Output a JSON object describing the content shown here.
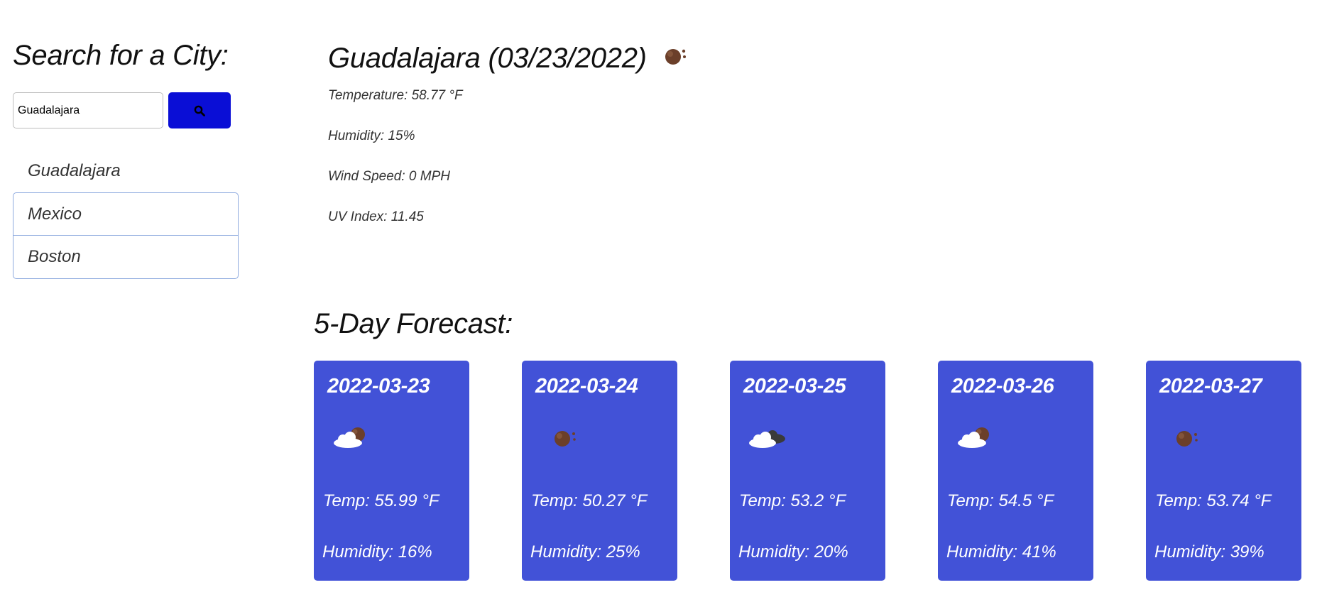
{
  "sidebar": {
    "title": "Search for a City:",
    "search_value": "Guadalajara",
    "search_button_icon": "search-icon",
    "history": [
      {
        "label": "Guadalajara"
      },
      {
        "label": "Mexico"
      },
      {
        "label": "Boston"
      }
    ]
  },
  "current": {
    "title": "Guadalajara (03/23/2022)",
    "icon": "clear-sky-icon",
    "temperature": "Temperature: 58.77 °F",
    "humidity": "Humidity: 15%",
    "wind_speed": "Wind Speed: 0 MPH",
    "uv_index": "UV Index: 11.45"
  },
  "forecast": {
    "title": "5-Day Forecast:",
    "days": [
      {
        "date": "2022-03-23",
        "icon": "few-clouds-icon",
        "temp": "Temp: 55.99 °F",
        "humidity": "Humidity: 16%"
      },
      {
        "date": "2022-03-24",
        "icon": "clear-sky-icon",
        "temp": "Temp: 50.27 °F",
        "humidity": "Humidity: 25%"
      },
      {
        "date": "2022-03-25",
        "icon": "broken-clouds-icon",
        "temp": "Temp: 53.2 °F",
        "humidity": "Humidity: 20%"
      },
      {
        "date": "2022-03-26",
        "icon": "few-clouds-icon",
        "temp": "Temp: 54.5 °F",
        "humidity": "Humidity: 41%"
      },
      {
        "date": "2022-03-27",
        "icon": "clear-sky-icon",
        "temp": "Temp: 53.74 °F",
        "humidity": "Humidity: 39%"
      }
    ]
  },
  "colors": {
    "search_button": "#0a0ed6",
    "card_background": "#4252d7",
    "history_border": "#8eaadf",
    "icon_brown": "#6b3f2a"
  }
}
